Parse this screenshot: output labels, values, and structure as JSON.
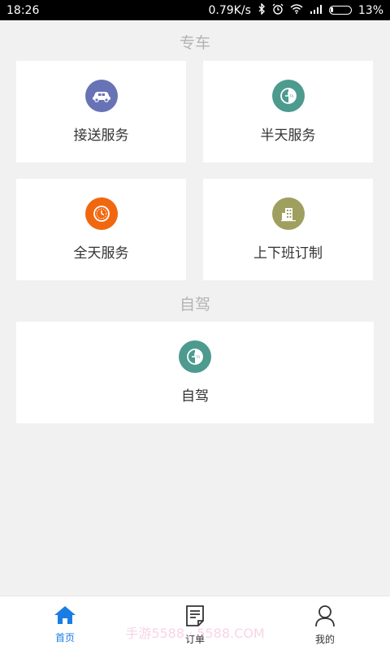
{
  "status_bar": {
    "time": "18:26",
    "network_speed": "0.79K/s",
    "battery": "13%"
  },
  "sections": {
    "chauffeur_title": "专车",
    "self_drive_title": "自驾"
  },
  "cards": {
    "pickup": {
      "label": "接送服务",
      "color": "#6873b6",
      "icon": "car-icon"
    },
    "half_day": {
      "label": "半天服务",
      "color": "#4d9a8f",
      "icon": "half-clock-icon"
    },
    "full_day": {
      "label": "全天服务",
      "color": "#f1670f",
      "icon": "clock-icon"
    },
    "commute": {
      "label": "上下班订制",
      "color": "#9f9f5f",
      "icon": "building-icon"
    },
    "self_drive": {
      "label": "自驾",
      "color": "#4d9a8f",
      "icon": "half-clock-icon"
    }
  },
  "tabbar": {
    "home": {
      "label": "首页",
      "icon": "home-icon",
      "active_color": "#1a7de3"
    },
    "orders": {
      "label": "订单",
      "icon": "order-list-icon"
    },
    "mine": {
      "label": "我的",
      "icon": "user-icon"
    }
  },
  "watermark": "手游5588 · 5588.COM"
}
